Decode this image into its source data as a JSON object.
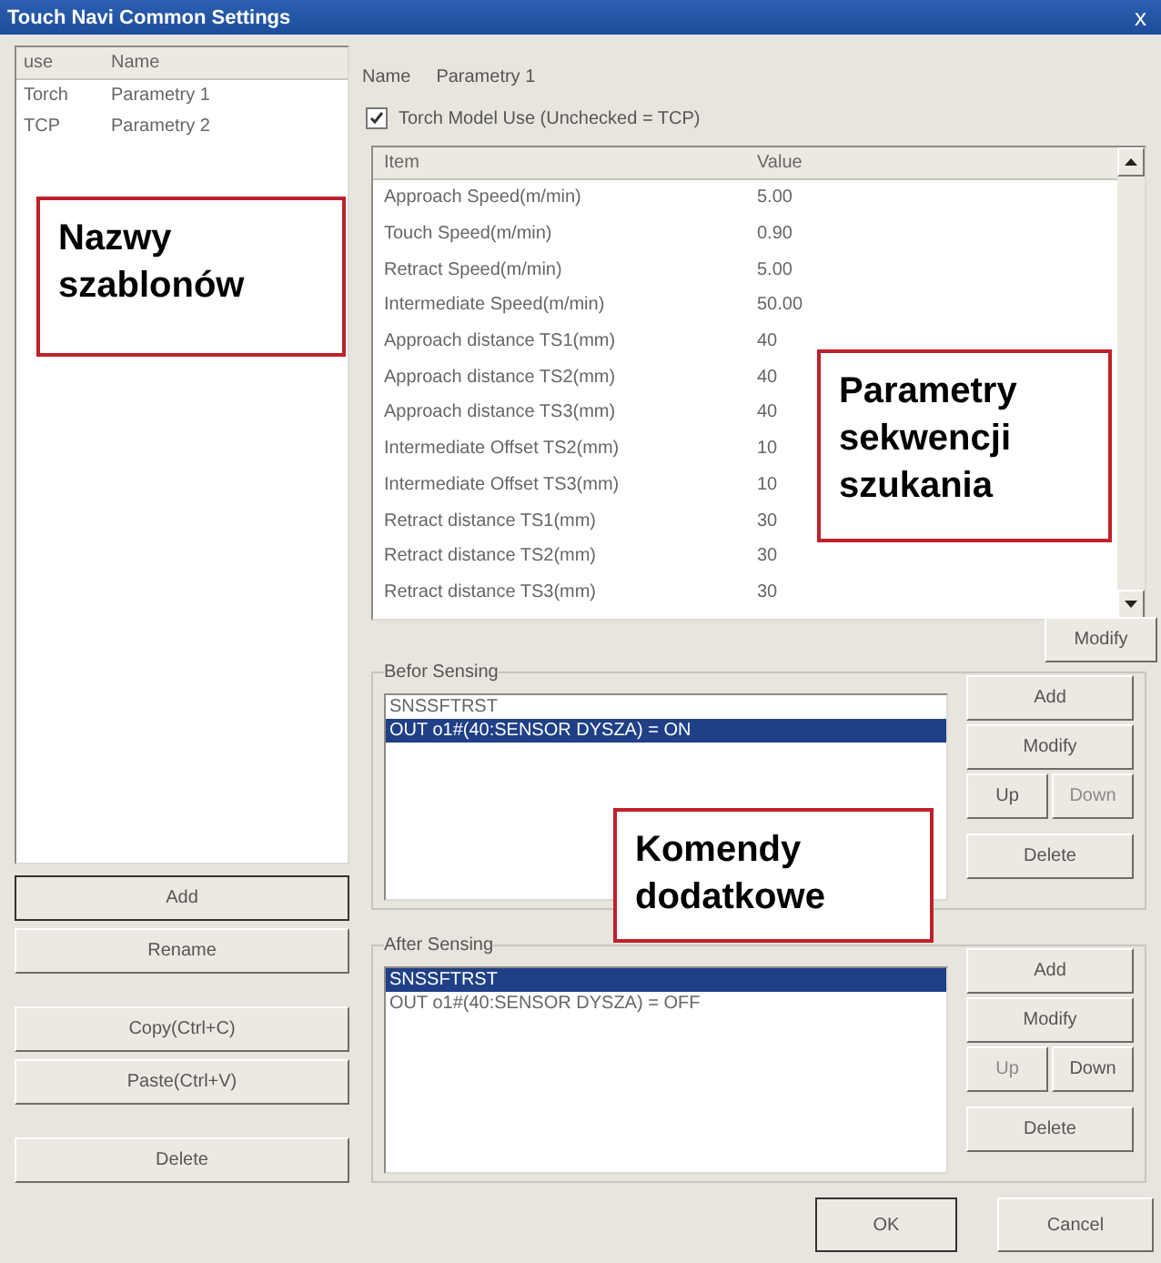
{
  "window": {
    "title": "Touch Navi Common Settings",
    "close": "x"
  },
  "templates": {
    "columns": [
      "use",
      "Name"
    ],
    "rows": [
      {
        "use": "Torch",
        "name": "Parametry 1"
      },
      {
        "use": "TCP",
        "name": "Parametry 2"
      }
    ],
    "button_groups": [
      [
        {
          "label": "Add",
          "default": true
        },
        {
          "label": "Rename",
          "default": false
        }
      ],
      [
        {
          "label": "Copy(Ctrl+C)",
          "default": false
        },
        {
          "label": "Paste(Ctrl+V)",
          "default": false
        }
      ],
      [
        {
          "label": "Delete",
          "default": false
        }
      ]
    ]
  },
  "name_label": "Name",
  "name_value": "Parametry 1",
  "torch_model": {
    "label": "Torch Model Use (Unchecked = TCP)",
    "checked": true
  },
  "params": {
    "columns": [
      "Item",
      "Value"
    ],
    "rows": [
      [
        "Approach Speed(m/min)",
        "5.00"
      ],
      [
        "Touch Speed(m/min)",
        "0.90"
      ],
      [
        "Retract Speed(m/min)",
        "5.00"
      ],
      [
        "Intermediate Speed(m/min)",
        "50.00"
      ],
      [
        "Approach distance TS1(mm)",
        "40"
      ],
      [
        "Approach distance TS2(mm)",
        "40"
      ],
      [
        "Approach distance TS3(mm)",
        "40"
      ],
      [
        "Intermediate Offset TS2(mm)",
        "10"
      ],
      [
        "Intermediate Offset TS3(mm)",
        "10"
      ],
      [
        "Retract distance TS1(mm)",
        "30"
      ],
      [
        "Retract distance TS2(mm)",
        "30"
      ],
      [
        "Retract distance TS3(mm)",
        "30"
      ]
    ],
    "modify": "Modify"
  },
  "groups": [
    {
      "title": "Befor Sensing",
      "items": [
        {
          "text": "SNSSFTRST",
          "selected": false
        },
        {
          "text": "OUT o1#(40:SENSOR DYSZA) = ON",
          "selected": true
        }
      ],
      "buttons": {
        "add": "Add",
        "modify": "Modify",
        "up": {
          "label": "Up",
          "disabled": false
        },
        "down": {
          "label": "Down",
          "disabled": true
        },
        "delete": "Delete"
      }
    },
    {
      "title": "After Sensing",
      "items": [
        {
          "text": "SNSSFTRST",
          "selected": true
        },
        {
          "text": "OUT o1#(40:SENSOR DYSZA) = OFF",
          "selected": false
        }
      ],
      "buttons": {
        "add": "Add",
        "modify": "Modify",
        "up": {
          "label": "Up",
          "disabled": true
        },
        "down": {
          "label": "Down",
          "disabled": false
        },
        "delete": "Delete"
      }
    }
  ],
  "footer": {
    "ok": "OK",
    "cancel": "Cancel"
  },
  "annotations": [
    {
      "lines": [
        "Nazwy",
        "szablonów"
      ]
    },
    {
      "lines": [
        "Parametry",
        "sekwencji",
        "szukania"
      ]
    },
    {
      "lines": [
        "Komendy",
        "dodatkowe"
      ]
    }
  ]
}
